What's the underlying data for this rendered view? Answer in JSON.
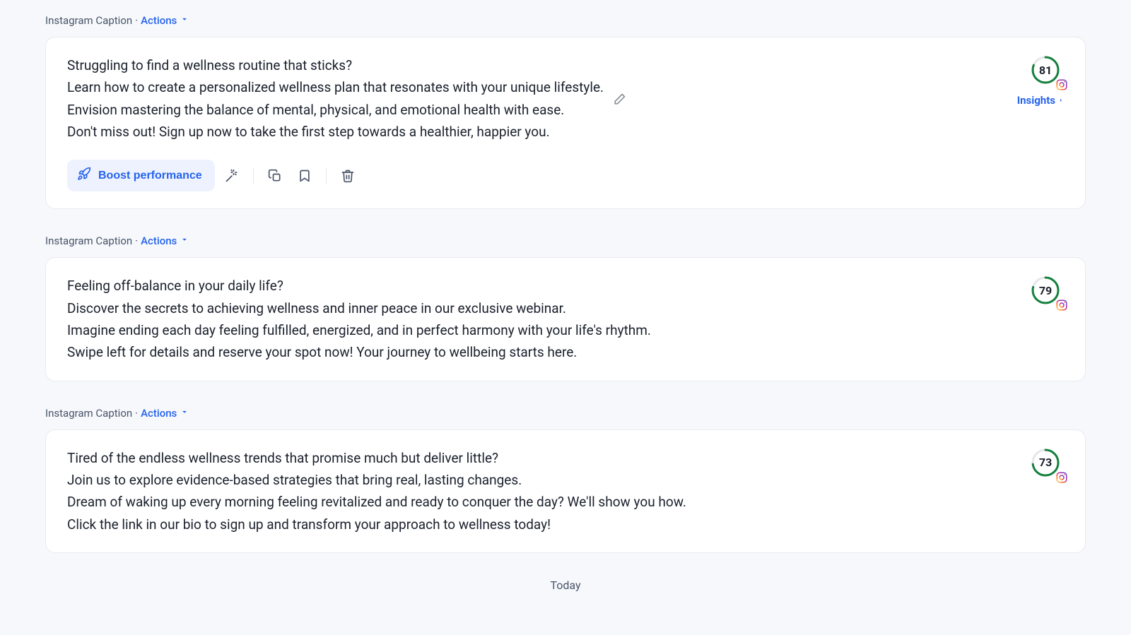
{
  "labels": {
    "caption_type": "Instagram Caption",
    "actions": "Actions",
    "boost": "Boost performance",
    "insights": "Insights",
    "today": "Today"
  },
  "cards": [
    {
      "score": 81,
      "show_toolbar": true,
      "show_edit": true,
      "show_insights": true,
      "lines": [
        "Struggling to find a wellness routine that sticks?",
        "Learn how to create a personalized wellness plan that resonates with your unique lifestyle.",
        "Envision mastering the balance of mental, physical, and emotional health with ease.",
        "Don't miss out! Sign up now to take the first step towards a healthier, happier you."
      ]
    },
    {
      "score": 79,
      "show_toolbar": false,
      "show_edit": false,
      "show_insights": false,
      "lines": [
        "Feeling off-balance in your daily life?",
        "Discover the secrets to achieving wellness and inner peace in our exclusive webinar.",
        "Imagine ending each day feeling fulfilled, energized, and in perfect harmony with your life's rhythm.",
        "Swipe left for details and reserve your spot now! Your journey to wellbeing starts here."
      ]
    },
    {
      "score": 73,
      "show_toolbar": false,
      "show_edit": false,
      "show_insights": false,
      "lines": [
        "Tired of the endless wellness trends that promise much but deliver little?",
        "Join us to explore evidence-based strategies that bring real, lasting changes.",
        "Dream of waking up every morning feeling revitalized and ready to conquer the day? We'll show you how.",
        "Click the link in our bio to sign up and transform your approach to wellness today!"
      ]
    }
  ]
}
